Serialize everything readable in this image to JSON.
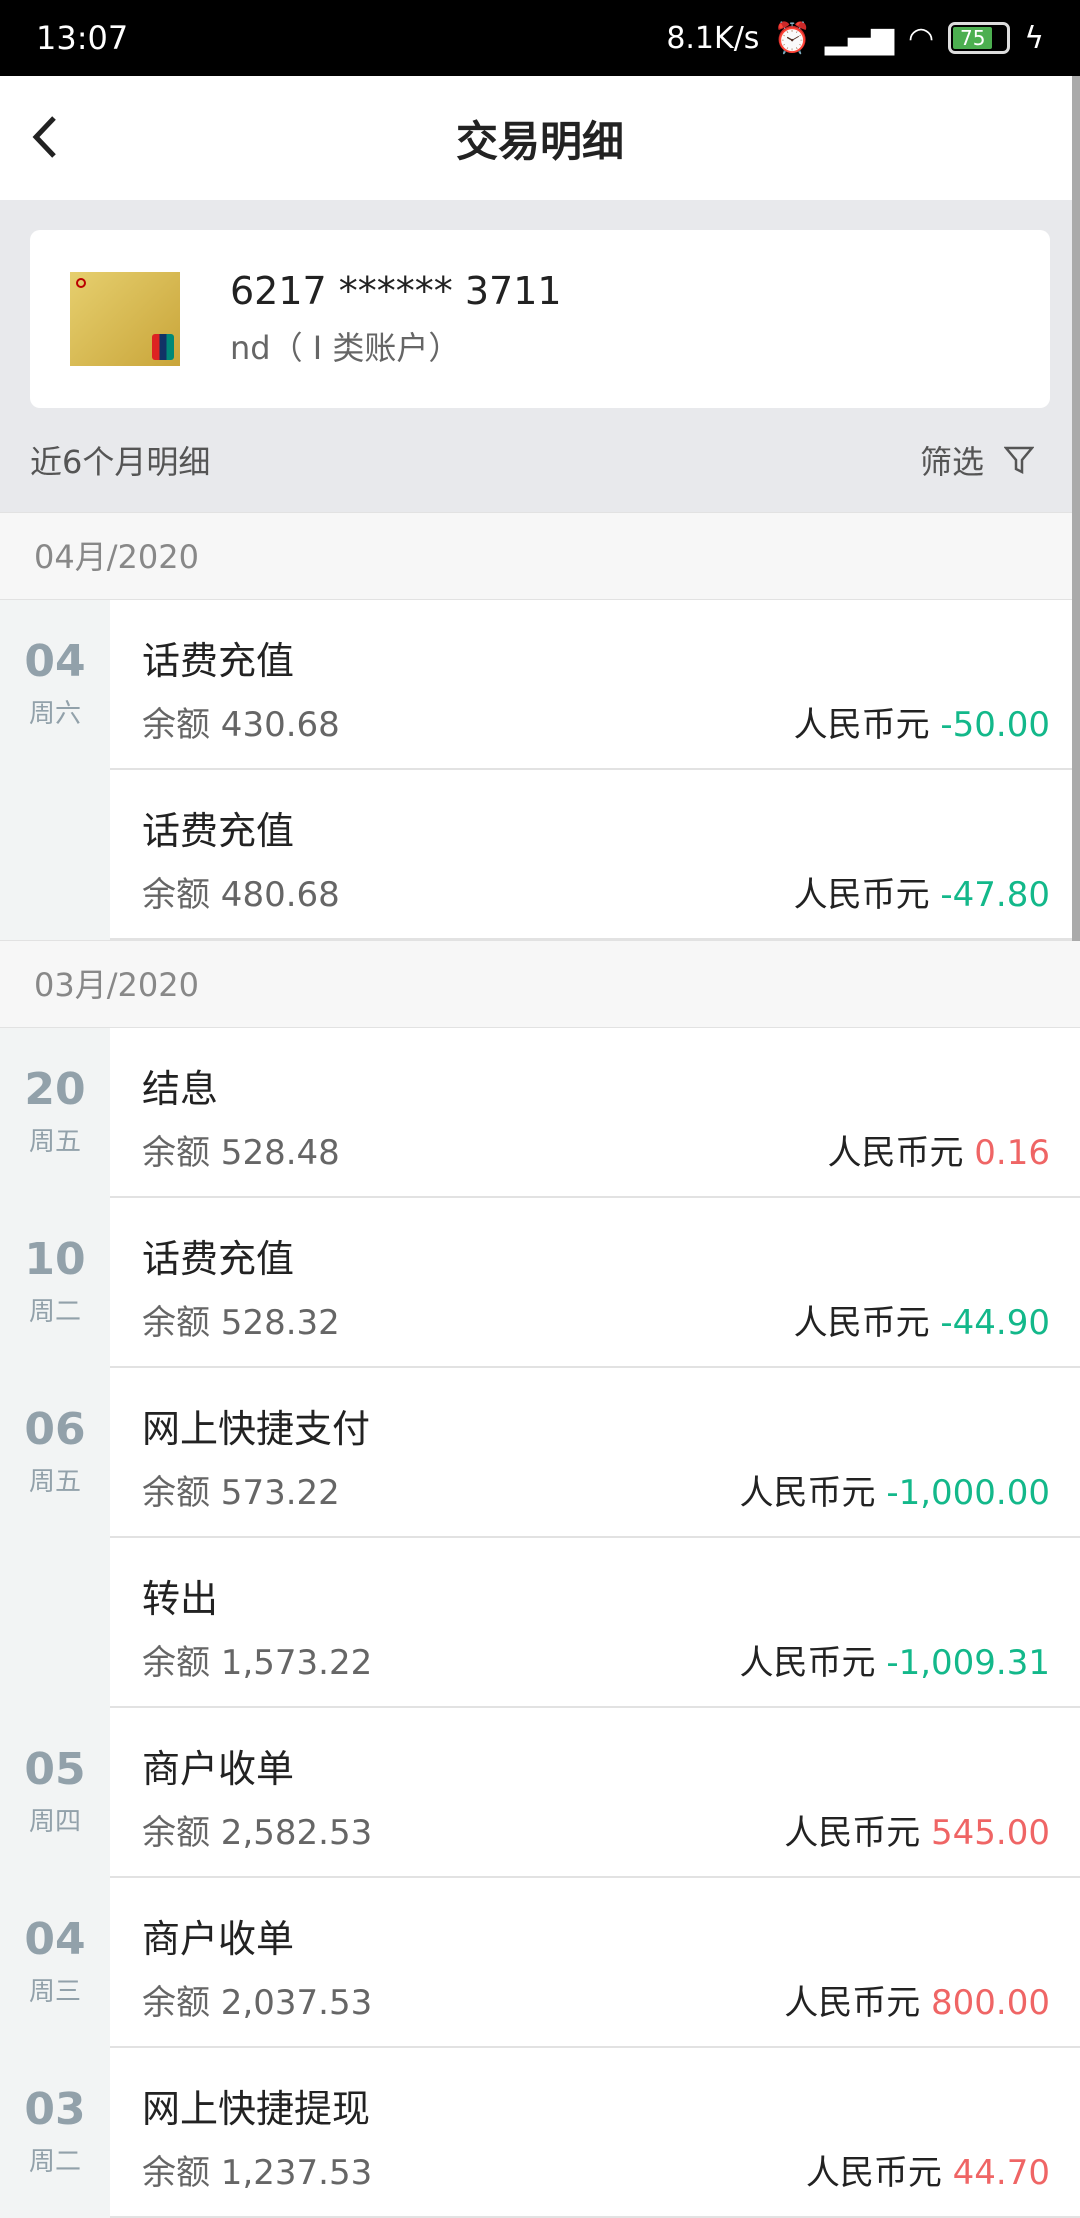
{
  "status_bar": {
    "time": "13:07",
    "net_speed": "8.1K/s",
    "battery": "75",
    "icons": [
      "alarm-icon",
      "hd-signal-icon",
      "signal-icon",
      "wifi-icon",
      "battery-icon",
      "charging-icon"
    ]
  },
  "header": {
    "title": "交易明细",
    "back_icon": "chevron-left-icon"
  },
  "account": {
    "number": "6217 ****** 3711",
    "type": "nd（ I 类账户）"
  },
  "filter_bar": {
    "range": "近6个月明细",
    "filter_label": "筛选",
    "filter_icon": "funnel-icon"
  },
  "colors": {
    "debit": "#13b88a",
    "credit": "#ef6565"
  },
  "groups": [
    {
      "month": "04月/2020",
      "rows": [
        {
          "day": "04",
          "weekday": "周六",
          "name": "话费充值",
          "balance": "余额 430.68",
          "currency": "人民币元",
          "amount": "-50.00",
          "kind": "neg"
        },
        {
          "day": "",
          "weekday": "",
          "name": "话费充值",
          "balance": "余额 480.68",
          "currency": "人民币元",
          "amount": "-47.80",
          "kind": "neg"
        }
      ]
    },
    {
      "month": "03月/2020",
      "rows": [
        {
          "day": "20",
          "weekday": "周五",
          "name": "结息",
          "balance": "余额 528.48",
          "currency": "人民币元",
          "amount": "0.16",
          "kind": "pos"
        },
        {
          "day": "10",
          "weekday": "周二",
          "name": "话费充值",
          "balance": "余额 528.32",
          "currency": "人民币元",
          "amount": "-44.90",
          "kind": "neg"
        },
        {
          "day": "06",
          "weekday": "周五",
          "name": "网上快捷支付",
          "balance": "余额 573.22",
          "currency": "人民币元",
          "amount": "-1,000.00",
          "kind": "neg"
        },
        {
          "day": "",
          "weekday": "",
          "name": "转出",
          "balance": "余额 1,573.22",
          "currency": "人民币元",
          "amount": "-1,009.31",
          "kind": "neg"
        },
        {
          "day": "05",
          "weekday": "周四",
          "name": "商户收单",
          "balance": "余额 2,582.53",
          "currency": "人民币元",
          "amount": "545.00",
          "kind": "pos"
        },
        {
          "day": "04",
          "weekday": "周三",
          "name": "商户收单",
          "balance": "余额 2,037.53",
          "currency": "人民币元",
          "amount": "800.00",
          "kind": "pos"
        },
        {
          "day": "03",
          "weekday": "周二",
          "name": "网上快捷提现",
          "balance": "余额 1,237.53",
          "currency": "人民币元",
          "amount": "44.70",
          "kind": "pos"
        }
      ]
    }
  ]
}
